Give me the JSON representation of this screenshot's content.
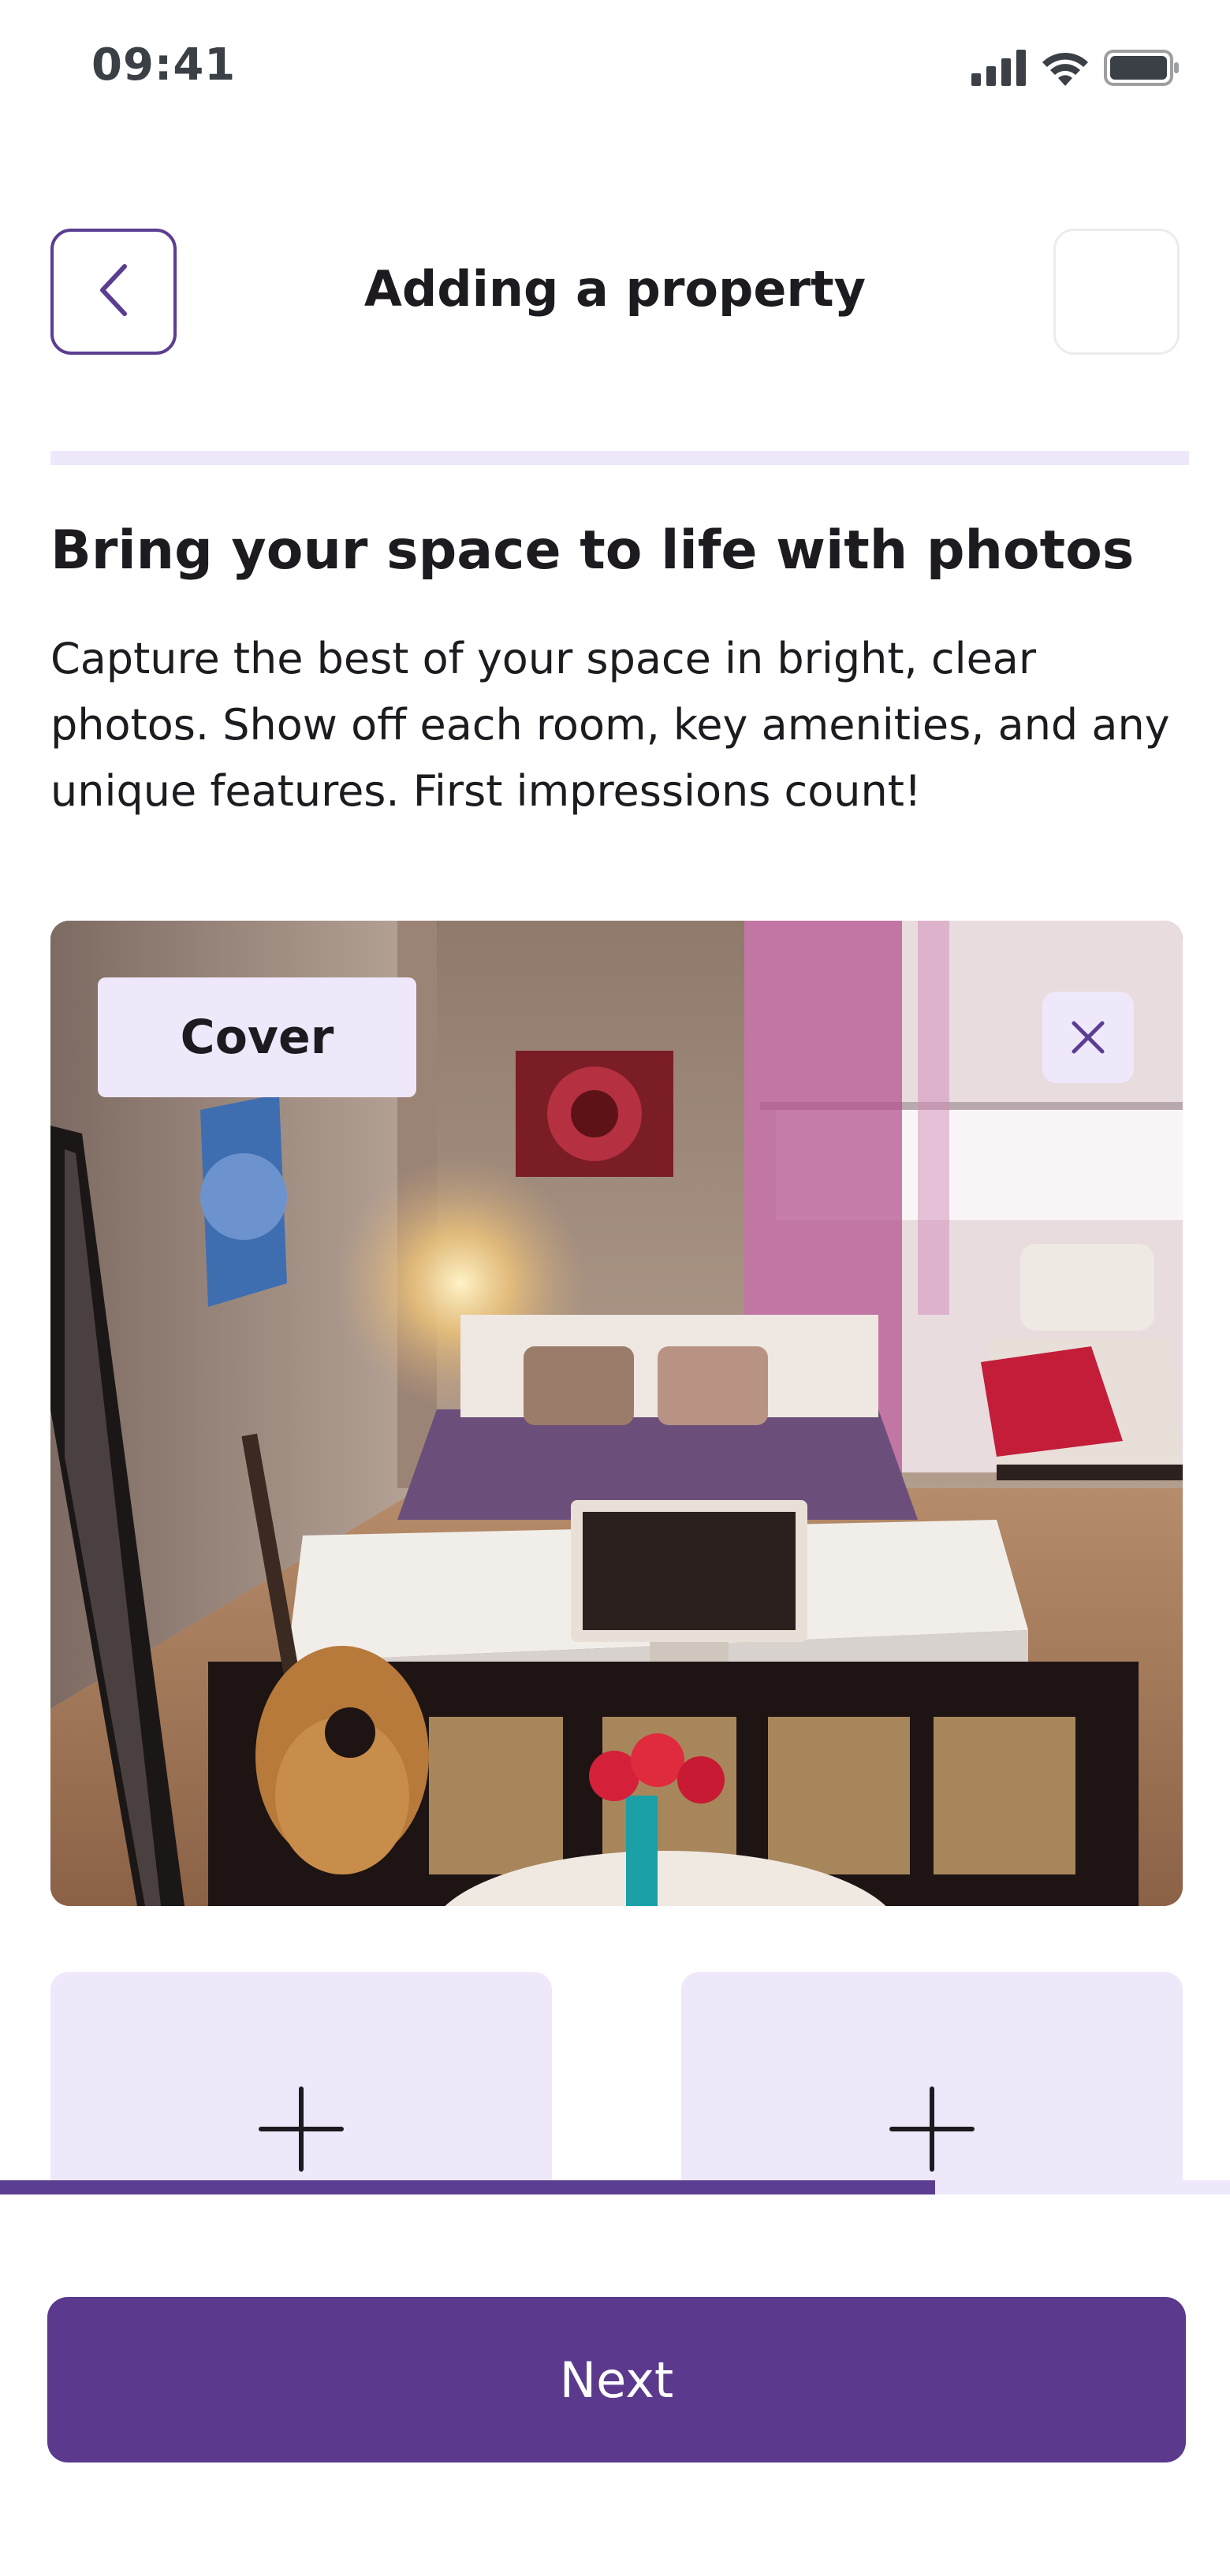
{
  "status_bar": {
    "time": "09:41",
    "icons": [
      "cellular-signal-icon",
      "wifi-icon",
      "battery-icon"
    ]
  },
  "header": {
    "title": "Adding a property",
    "back_icon": "chevron-left-icon"
  },
  "content": {
    "headline": "Bring your space to life with photos",
    "description": "Capture the best of your space in bright, clear photos. Show off each room, key amenities, and any unique features. First impressions count!"
  },
  "photos": {
    "cover_label": "Cover",
    "remove_icon": "close-icon",
    "add_slots": [
      {
        "icon": "plus-icon"
      },
      {
        "icon": "plus-icon"
      }
    ]
  },
  "progress": {
    "fraction": 0.76
  },
  "footer": {
    "next_label": "Next"
  },
  "colors": {
    "accent": "#5b3a8e",
    "accent_light": "#efe8fb"
  }
}
